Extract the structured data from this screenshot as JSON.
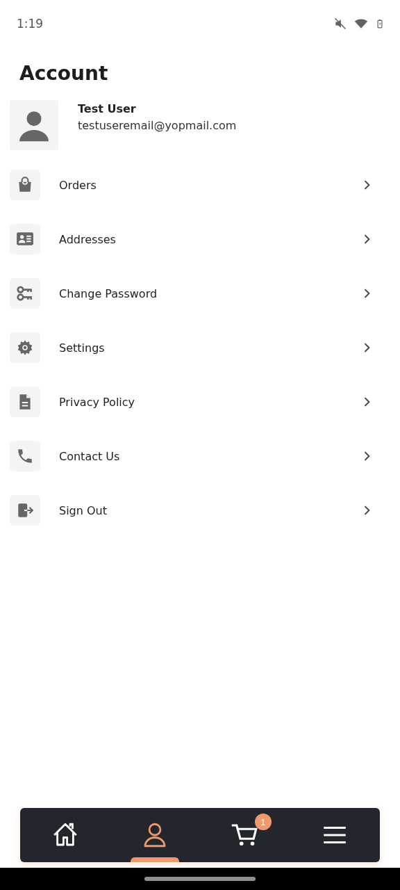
{
  "status_bar": {
    "time": "1:19"
  },
  "title": "Account",
  "profile": {
    "name": "Test User",
    "email": "testuseremail@yopmail.com"
  },
  "menu": [
    {
      "kind": "bag",
      "label": "Orders"
    },
    {
      "kind": "card",
      "label": "Addresses"
    },
    {
      "kind": "keys",
      "label": "Change Password"
    },
    {
      "kind": "gear",
      "label": "Settings"
    },
    {
      "kind": "doc",
      "label": "Privacy Policy"
    },
    {
      "kind": "phone",
      "label": "Contact Us"
    },
    {
      "kind": "exit",
      "label": "Sign Out"
    }
  ],
  "nav": [
    {
      "kind": "home",
      "selected": false
    },
    {
      "kind": "user",
      "selected": true
    },
    {
      "kind": "cart",
      "selected": false,
      "badge": "1"
    },
    {
      "kind": "menu",
      "selected": false
    }
  ]
}
